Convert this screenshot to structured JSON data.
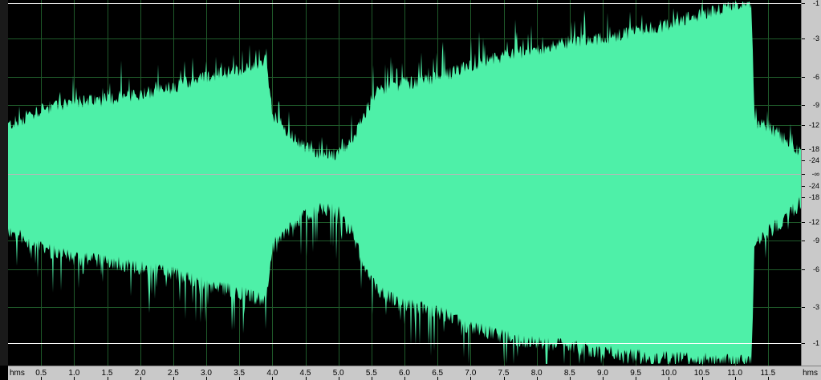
{
  "editor": {
    "waveform_color": "#4ef0a8",
    "background_color": "#000000",
    "grid_color": "#1f5a2a",
    "center_line_color": "#b8b8b8",
    "limit_line_color": "#ffffff"
  },
  "time_ruler": {
    "unit_left": "hms",
    "unit_right": "hms",
    "duration_seconds": 12.0,
    "labels": [
      "0.5",
      "1.0",
      "1.5",
      "2.0",
      "2.5",
      "3.0",
      "3.5",
      "4.0",
      "4.5",
      "5.0",
      "5.5",
      "6.0",
      "6.5",
      "7.0",
      "7.5",
      "8.0",
      "8.5",
      "9.0",
      "9.5",
      "10.0",
      "10.5",
      "11.0",
      "11.5"
    ]
  },
  "db_scale": {
    "upper": [
      "-1",
      "-3",
      "-6",
      "-9",
      "-12",
      "-18",
      "-24"
    ],
    "center": "-∞",
    "lower": [
      "-24",
      "-18",
      "-12",
      "-9",
      "-6",
      "-3",
      "-1"
    ]
  },
  "envelope": {
    "times": [
      0.0,
      0.3,
      0.6,
      1.0,
      1.5,
      2.0,
      2.5,
      3.0,
      3.5,
      3.9,
      4.0,
      4.2,
      4.5,
      4.8,
      5.0,
      5.2,
      5.4,
      5.6,
      6.0,
      6.5,
      7.0,
      7.5,
      8.0,
      8.5,
      9.0,
      9.5,
      10.0,
      10.5,
      11.0,
      11.25,
      11.3,
      11.6,
      12.0
    ],
    "top": [
      0.28,
      0.33,
      0.38,
      0.41,
      0.43,
      0.46,
      0.5,
      0.56,
      0.6,
      0.65,
      0.35,
      0.25,
      0.15,
      0.1,
      0.12,
      0.18,
      0.35,
      0.48,
      0.52,
      0.55,
      0.62,
      0.68,
      0.72,
      0.76,
      0.78,
      0.82,
      0.86,
      0.92,
      0.98,
      0.99,
      0.3,
      0.25,
      0.12
    ],
    "bottom": [
      0.3,
      0.35,
      0.4,
      0.44,
      0.46,
      0.49,
      0.52,
      0.58,
      0.62,
      0.66,
      0.38,
      0.3,
      0.22,
      0.18,
      0.2,
      0.3,
      0.5,
      0.62,
      0.68,
      0.72,
      0.8,
      0.85,
      0.88,
      0.9,
      0.93,
      0.95,
      0.96,
      0.97,
      0.98,
      0.99,
      0.35,
      0.28,
      0.15
    ]
  }
}
